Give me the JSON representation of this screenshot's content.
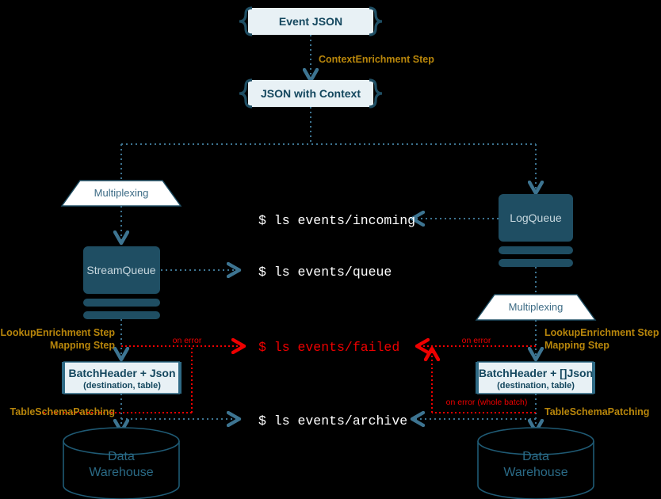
{
  "diagram": {
    "title": "Event pipeline flow",
    "colors": {
      "background": "#000000",
      "queue_fill": "#1f4e63",
      "doc_fill": "#e8f1f5",
      "accent_line": "#3d7491",
      "error_red": "#ee0000",
      "step_orange": "#b8860b",
      "terminal_white": "#ffffff",
      "node_stroke": "#1f4e63"
    },
    "top": {
      "event_json": "Event JSON",
      "context_step": "ContextEnrichment Step",
      "json_with_context": "JSON with Context"
    },
    "left_branch": {
      "multiplexing": "Multiplexing",
      "queue": "StreamQueue",
      "steps_line1": "LookupEnrichment Step",
      "steps_line2": "Mapping Step",
      "batch_title": "BatchHeader + Json",
      "batch_subtitle": "(destination, table)",
      "patching": "TableSchemaPatching",
      "on_error": "on error",
      "warehouse_line1": "Data",
      "warehouse_line2": "Warehouse"
    },
    "right_branch": {
      "multiplexing": "Multiplexing",
      "queue": "LogQueue",
      "steps_line1": "LookupEnrichment Step",
      "steps_line2": "Mapping Step",
      "batch_title": "BatchHeader + []Json",
      "batch_subtitle": "(destination, table)",
      "patching": "TableSchemaPatching",
      "on_error": "on error",
      "on_error_batch": "on error (whole batch)",
      "warehouse_line1": "Data",
      "warehouse_line2": "Warehouse"
    },
    "terminal": {
      "incoming": "$ ls events/incoming",
      "queue": "$ ls events/queue",
      "failed": "$ ls events/failed",
      "archive": "$ ls events/archive"
    }
  }
}
